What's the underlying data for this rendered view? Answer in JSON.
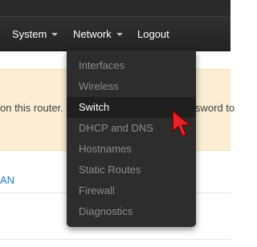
{
  "navbar": {
    "items": [
      {
        "label": "System",
        "has_caret": true
      },
      {
        "label": "Network",
        "has_caret": true
      },
      {
        "label": "Logout",
        "has_caret": false
      }
    ]
  },
  "alert": {
    "text_left": "on this router.",
    "text_right": "sword to"
  },
  "content": {
    "link_fragment": "AN"
  },
  "network_menu": {
    "items": [
      {
        "label": "Interfaces"
      },
      {
        "label": "Wireless"
      },
      {
        "label": "Switch",
        "active": true
      },
      {
        "label": "DHCP and DNS"
      },
      {
        "label": "Hostnames"
      },
      {
        "label": "Static Routes"
      },
      {
        "label": "Firewall"
      },
      {
        "label": "Diagnostics"
      }
    ]
  },
  "colors": {
    "navbar": "#2a2a2a",
    "alert_bg": "#fbeed5",
    "link": "#2277c8",
    "cursor": "#e8202a"
  },
  "icons": {
    "cursor": "mouse-pointer-icon",
    "caret": "caret-down-icon"
  }
}
